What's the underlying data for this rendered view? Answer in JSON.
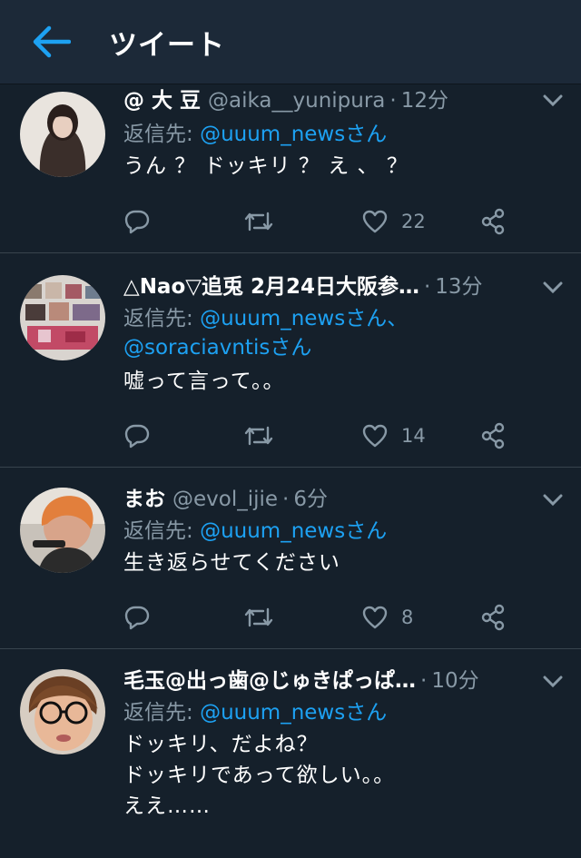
{
  "header": {
    "title": "ツイート",
    "accent": "#1da1f2"
  },
  "tweets": [
    {
      "name": "@ 大 豆",
      "handle": "@aika__yunipura",
      "time": "12分",
      "reply_prefix": "返信先: ",
      "reply_mentions": "@uuum_newsさん",
      "reply_line2": "",
      "text": "うん ？ ドッキリ ？ え 、 ？",
      "likes": "22"
    },
    {
      "name": "△Nao▽追兎  2月24日大阪参…",
      "handle": "",
      "time": "13分",
      "reply_prefix": "返信先: ",
      "reply_mentions": "@uuum_newsさん、",
      "reply_line2": "@soraciavntisさん",
      "text": "嘘って言って。。",
      "likes": "14"
    },
    {
      "name": "まお",
      "handle": "@evol_ijie",
      "time": "6分",
      "reply_prefix": "返信先: ",
      "reply_mentions": "@uuum_newsさん",
      "reply_line2": "",
      "text": "生き返らせてください",
      "likes": "8"
    },
    {
      "name": "毛玉@出っ歯@じゅきぱっぱ…",
      "handle": "",
      "time": "10分",
      "reply_prefix": "返信先: ",
      "reply_mentions": "@uuum_newsさん",
      "reply_line2": "",
      "text": "ドッキリ、だよね？\nドッキリであって欲しい。。\nええ……",
      "likes": ""
    }
  ]
}
